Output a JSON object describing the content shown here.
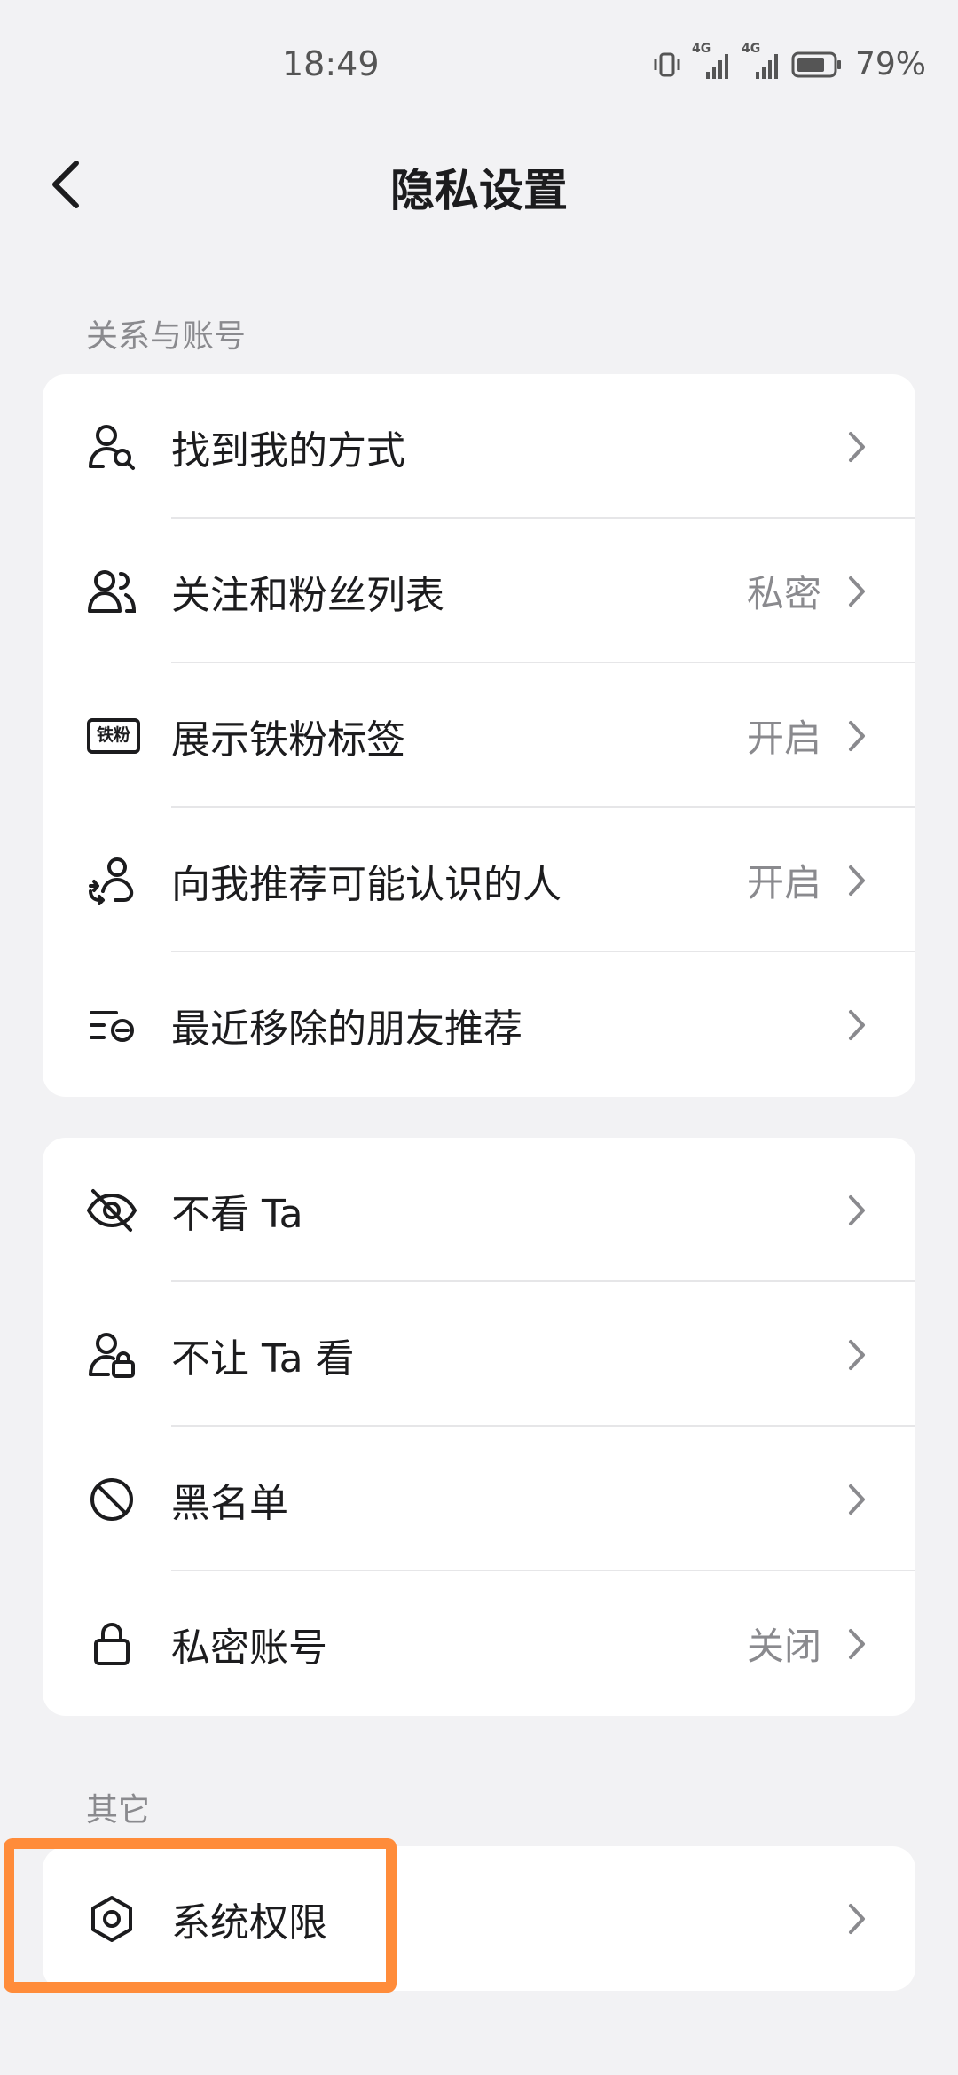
{
  "status_bar": {
    "time": "18:49",
    "network_1": "4G",
    "network_2": "4G",
    "battery_percent": "79%"
  },
  "header": {
    "title": "隐私设置"
  },
  "sections": {
    "relations_label": "关系与账号",
    "other_label": "其它"
  },
  "card1": {
    "items": [
      {
        "label": "找到我的方式",
        "value": "",
        "icon": "person-search-icon"
      },
      {
        "label": "关注和粉丝列表",
        "value": "私密",
        "icon": "people-icon"
      },
      {
        "label": "展示铁粉标签",
        "value": "开启",
        "icon": "fan-badge-icon",
        "badge_text": "铁粉"
      },
      {
        "label": "向我推荐可能认识的人",
        "value": "开启",
        "icon": "recommend-person-icon"
      },
      {
        "label": "最近移除的朋友推荐",
        "value": "",
        "icon": "removed-list-icon"
      }
    ]
  },
  "card2": {
    "items": [
      {
        "label": "不看 Ta",
        "value": "",
        "icon": "eye-off-icon"
      },
      {
        "label": "不让 Ta 看",
        "value": "",
        "icon": "person-lock-icon"
      },
      {
        "label": "黑名单",
        "value": "",
        "icon": "block-icon"
      },
      {
        "label": "私密账号",
        "value": "关闭",
        "icon": "lock-icon"
      }
    ]
  },
  "card3": {
    "items": [
      {
        "label": "系统权限",
        "value": "",
        "icon": "hexagon-settings-icon"
      }
    ]
  },
  "colors": {
    "background": "#f2f2f4",
    "card": "#ffffff",
    "highlight": "#ff8c3a",
    "secondary_text": "#8a8a8e"
  }
}
